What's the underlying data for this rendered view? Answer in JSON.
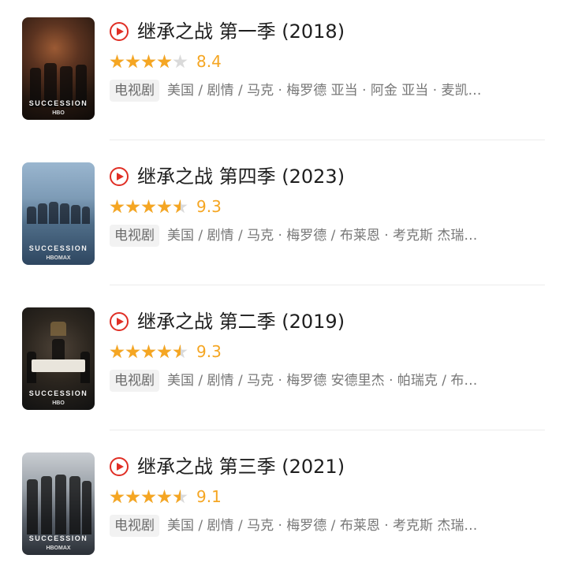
{
  "items": [
    {
      "title": "继承之战 第一季 (2018)",
      "rating": "8.4",
      "rating_fraction": 0.84,
      "tag": "电视剧",
      "info": "美国 / 剧情 / 马克 · 梅罗德 亚当 · 阿金 亚当 · 麦凯…",
      "poster_text": "SUCCESSION",
      "poster_brand": "HBO"
    },
    {
      "title": "继承之战 第四季 (2023)",
      "rating": "9.3",
      "rating_fraction": 0.93,
      "tag": "电视剧",
      "info": "美国 / 剧情 / 马克 · 梅罗德 / 布莱恩 · 考克斯 杰瑞…",
      "poster_text": "SUCCESSION",
      "poster_brand": "HBOMAX"
    },
    {
      "title": "继承之战 第二季 (2019)",
      "rating": "9.3",
      "rating_fraction": 0.93,
      "tag": "电视剧",
      "info": "美国 / 剧情 / 马克 · 梅罗德 安德里杰 · 帕瑞克 / 布…",
      "poster_text": "SUCCESSION",
      "poster_brand": "HBO"
    },
    {
      "title": "继承之战 第三季 (2021)",
      "rating": "9.1",
      "rating_fraction": 0.91,
      "tag": "电视剧",
      "info": "美国 / 剧情 / 马克 · 梅罗德 / 布莱恩 · 考克斯 杰瑞…",
      "poster_text": "SUCCESSION",
      "poster_brand": "HBOMAX"
    }
  ],
  "colors": {
    "accent_red": "#e02e24",
    "star_orange": "#f5a623",
    "star_empty": "#dadada"
  },
  "icons": {
    "play": "play-circle-icon",
    "star": "star-icon"
  }
}
